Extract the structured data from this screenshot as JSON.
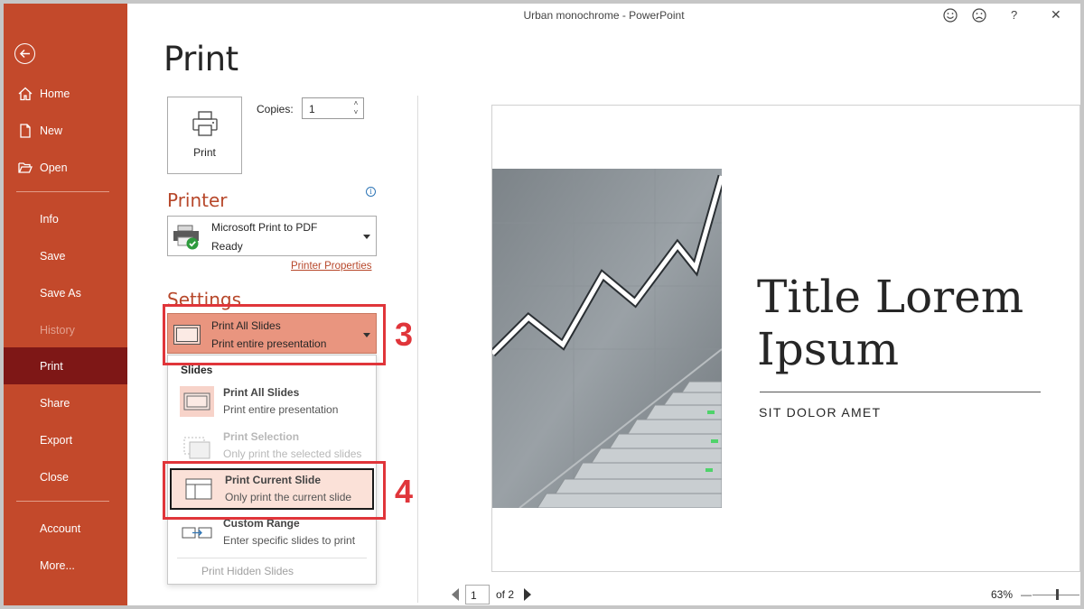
{
  "window": {
    "title": "Urban monochrome  -  PowerPoint"
  },
  "titlebar_icons": [
    "smile-icon",
    "frown-icon",
    "help-icon",
    "close-icon"
  ],
  "help_glyph": "?",
  "close_glyph": "✕",
  "sidebar": {
    "items": [
      {
        "label": "Home",
        "icon": "home-icon"
      },
      {
        "label": "New",
        "icon": "new-file-icon"
      },
      {
        "label": "Open",
        "icon": "folder-open-icon"
      },
      {
        "label": "Info"
      },
      {
        "label": "Save"
      },
      {
        "label": "Save As"
      },
      {
        "label": "History",
        "disabled": true
      },
      {
        "label": "Print",
        "selected": true
      },
      {
        "label": "Share"
      },
      {
        "label": "Export"
      },
      {
        "label": "Close"
      },
      {
        "label": "Account"
      },
      {
        "label": "More..."
      }
    ]
  },
  "print": {
    "page_title": "Print",
    "print_button_label": "Print",
    "copies_label": "Copies:",
    "copies_value": "1",
    "spin_up": "˄",
    "spin_down": "˅",
    "printer_heading": "Printer",
    "info_glyph": "i",
    "printer_name": "Microsoft Print to PDF",
    "printer_status": "Ready",
    "printer_properties": "Printer Properties",
    "settings_heading": "Settings",
    "selected_option_title": "Print All Slides",
    "selected_option_desc": "Print entire presentation"
  },
  "menu": {
    "heading": "Slides",
    "items": [
      {
        "title": "Print All Slides",
        "desc": "Print entire presentation"
      },
      {
        "title": "Print Selection",
        "desc": "Only print the selected slides",
        "disabled": true
      },
      {
        "title": "Print Current Slide",
        "desc": "Only print the current slide",
        "highlighted": true
      },
      {
        "title": "Custom Range",
        "desc": "Enter specific slides to print"
      }
    ],
    "footer": "Print Hidden Slides"
  },
  "annotations": {
    "step3": "3",
    "step4": "4"
  },
  "preview": {
    "slide_title": "Title Lorem Ipsum",
    "slide_subtitle": "SIT DOLOR AMET",
    "current_page": "1",
    "page_of": "of 2",
    "zoom": "63%",
    "zoom_minus": "—",
    "zoom_level": 0.52
  },
  "colors": {
    "sidebar": "#c3492b",
    "sidebar_selected": "#7e1716",
    "accent": "#b7472a",
    "highlight": "#e0353a"
  }
}
